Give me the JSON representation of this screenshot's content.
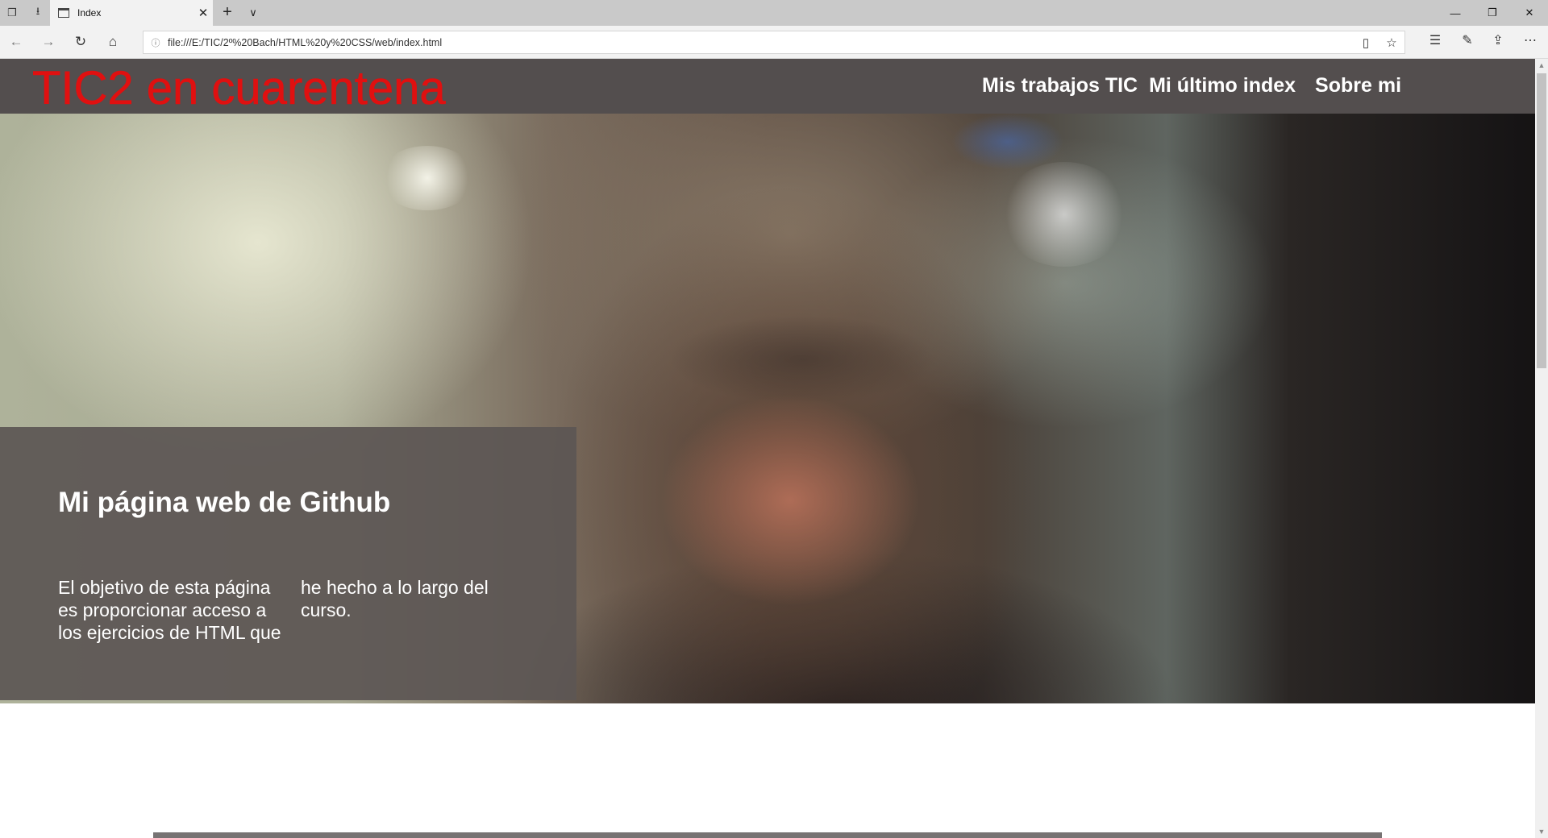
{
  "browser": {
    "tab_title": "Index",
    "url": "file:///E:/TIC/2º%20Bach/HTML%20y%20CSS/web/index.html"
  },
  "site": {
    "logo": "TIC2 en cuarentena",
    "nav": [
      "Mis trabajos TIC",
      "Mi último index",
      "Sobre mi"
    ],
    "hero": {
      "title": "Mi página web de Github",
      "text": "El objetivo de esta página es proporcionar acceso a los ejercicios de HTML que he hecho a lo largo del curso."
    }
  },
  "colors": {
    "header_bg": "#534e4e",
    "logo": "#e01010",
    "overlay": "#5c5654"
  }
}
